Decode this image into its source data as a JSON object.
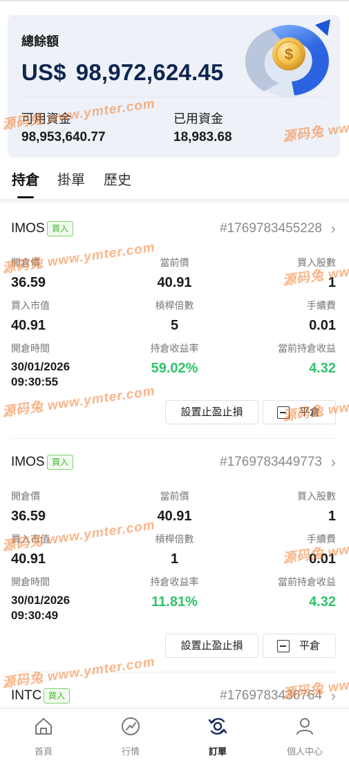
{
  "balance": {
    "title": "總餘額",
    "currency": "US$",
    "amount": "98,972,624.45",
    "available_label": "可用資金",
    "available_value": "98,953,640.77",
    "used_label": "已用資金",
    "used_value": "18,983.68"
  },
  "tabs": [
    "持倉",
    "掛單",
    "歷史"
  ],
  "active_tab": 0,
  "field_labels": {
    "open_price": "開倉價",
    "current_price": "當前價",
    "shares": "買入股數",
    "market_value": "買入市值",
    "leverage": "槓桿倍數",
    "fee": "手續費",
    "open_time": "開倉時間",
    "return_rate": "持倉收益率",
    "current_profit": "當前持倉收益"
  },
  "actions": {
    "tp_sl": "設置止盈止損",
    "close": "平倉"
  },
  "orders": [
    {
      "symbol": "IMOS",
      "side": "買入",
      "id": "#1769783455228",
      "open_price": "36.59",
      "current_price": "40.91",
      "shares": "1",
      "market_value": "40.91",
      "leverage": "5",
      "fee": "0.01",
      "open_date": "30/01/2026",
      "open_clock": "09:30:55",
      "return_rate": "59.02%",
      "current_profit": "4.32"
    },
    {
      "symbol": "IMOS",
      "side": "買入",
      "id": "#1769783449773",
      "open_price": "36.59",
      "current_price": "40.91",
      "shares": "1",
      "market_value": "40.91",
      "leverage": "1",
      "fee": "0.01",
      "open_date": "30/01/2026",
      "open_clock": "09:30:49",
      "return_rate": "11.81%",
      "current_profit": "4.32"
    },
    {
      "symbol": "INTC",
      "side": "買入",
      "id": "#1769783436764"
    }
  ],
  "watermark": {
    "brand": "源码兔",
    "url": "www.ymter.com"
  },
  "nav": [
    {
      "label": "首頁",
      "icon": "home-icon"
    },
    {
      "label": "行情",
      "icon": "market-icon"
    },
    {
      "label": "訂單",
      "icon": "orders-icon"
    },
    {
      "label": "個人中心",
      "icon": "user-icon"
    }
  ],
  "active_nav": 2,
  "colors": {
    "accent_green": "#2fc36a",
    "badge_green": "#3fb52a",
    "navy": "#0f2550"
  }
}
